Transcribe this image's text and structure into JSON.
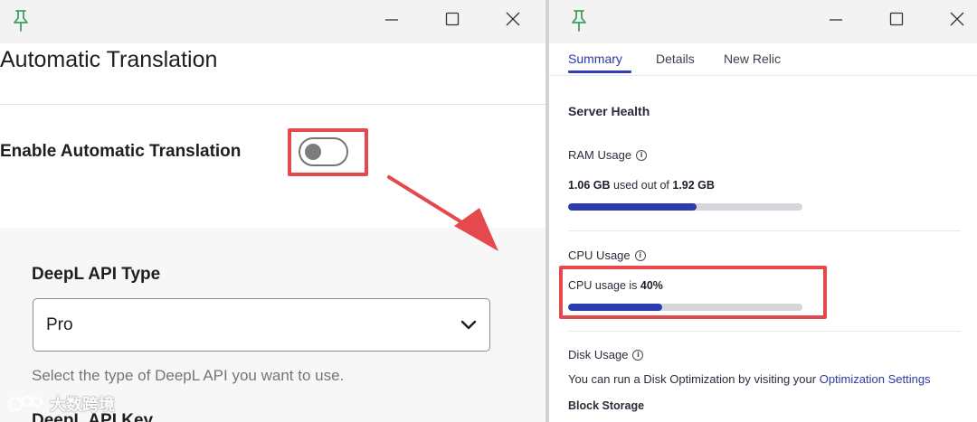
{
  "left_window": {
    "page_title": "Automatic Translation",
    "enable_label": "Enable Automatic Translation",
    "toggle_state": "off",
    "api_type": {
      "label": "DeepL API Type",
      "selected": "Pro",
      "help_text": "Select the type of DeepL API you want to use."
    },
    "api_key_label": "DeepL API Key",
    "watermark": "大数跨境"
  },
  "right_window": {
    "tabs": [
      {
        "label": "Summary",
        "active": true
      },
      {
        "label": "Details",
        "active": false
      },
      {
        "label": "New Relic",
        "active": false
      }
    ],
    "section_title": "Server Health",
    "ram": {
      "label": "RAM Usage",
      "used": "1.06 GB",
      "middle": " used out of ",
      "total": "1.92 GB",
      "fraction": 0.55
    },
    "cpu": {
      "label": "CPU Usage",
      "prefix": "CPU usage is ",
      "value": "40%",
      "fraction": 0.4
    },
    "disk": {
      "label": "Disk Usage",
      "text": "You can run a Disk Optimization by visiting your ",
      "link": "Optimization Settings"
    },
    "block_storage": "Block Storage"
  },
  "colors": {
    "highlight": "#e5484d",
    "accent": "#2c3bb0",
    "pin": "#3aa35a"
  }
}
